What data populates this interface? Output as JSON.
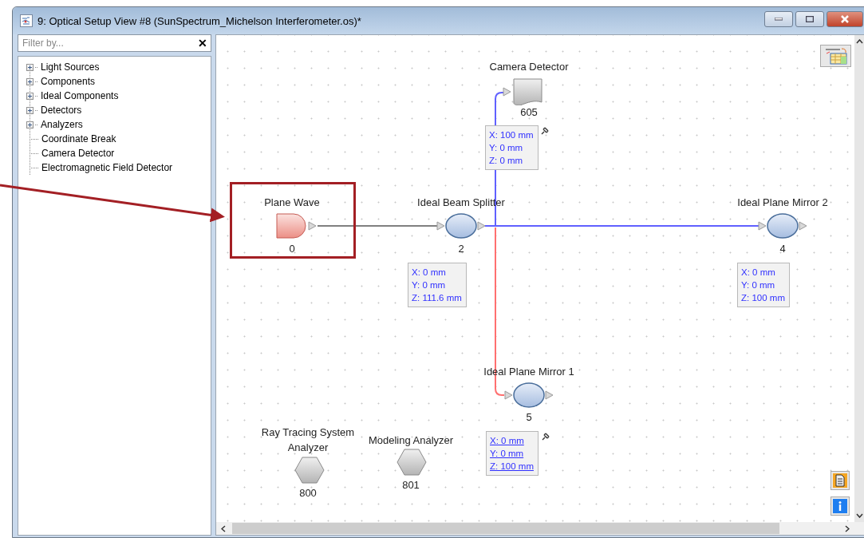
{
  "window": {
    "title": "9: Optical Setup View #8 (SunSpectrum_Michelson Interferometer.os)*"
  },
  "filter": {
    "placeholder": "Filter by...",
    "clear_symbol": "✕"
  },
  "tree": [
    {
      "label": "Light Sources",
      "kind": "folder",
      "expanded": false
    },
    {
      "label": "Components",
      "kind": "folder",
      "expanded": false
    },
    {
      "label": "Ideal Components",
      "kind": "folder",
      "expanded": false
    },
    {
      "label": "Detectors",
      "kind": "folder",
      "expanded": false
    },
    {
      "label": "Analyzers",
      "kind": "folder",
      "expanded": false
    },
    {
      "label": "Coordinate Break",
      "kind": "leaf"
    },
    {
      "label": "Camera Detector",
      "kind": "leaf"
    },
    {
      "label": "Electromagnetic Field Detector",
      "kind": "leaf"
    }
  ],
  "beams": [
    {
      "color": "#808080"
    },
    {
      "color": "#6060ff"
    },
    {
      "color": "#6060ff"
    },
    {
      "color": "#ff7070"
    }
  ],
  "nodes": [
    {
      "kind": "source",
      "label": "Plane Wave",
      "number": "0"
    },
    {
      "kind": "oval",
      "label": "Ideal Beam Splitter",
      "number": "2",
      "position": [
        "X: 0 mm",
        "Y: 0 mm",
        "Z: 111.6 mm"
      ],
      "underlined": false
    },
    {
      "kind": "oval",
      "label": "Ideal Plane Mirror 2",
      "number": "4",
      "position": [
        "X: 0 mm",
        "Y: 0 mm",
        "Z: 100 mm"
      ],
      "underlined": false
    },
    {
      "kind": "camera",
      "label": "Camera Detector",
      "number": "605",
      "position": [
        "X: 100 mm",
        "Y: 0 mm",
        "Z: 0 mm"
      ],
      "pinned": true,
      "underlined": false
    },
    {
      "kind": "oval",
      "label": "Ideal Plane Mirror 1",
      "number": "5",
      "position": [
        "X: 0 mm",
        "Y: 0 mm",
        "Z: 100 mm"
      ],
      "pinned": true,
      "underlined": true
    },
    {
      "kind": "analyzer",
      "label": "Ray Tracing System Analyzer",
      "number": "800"
    },
    {
      "kind": "analyzer",
      "label": "Modeling Analyzer",
      "number": "801"
    }
  ]
}
